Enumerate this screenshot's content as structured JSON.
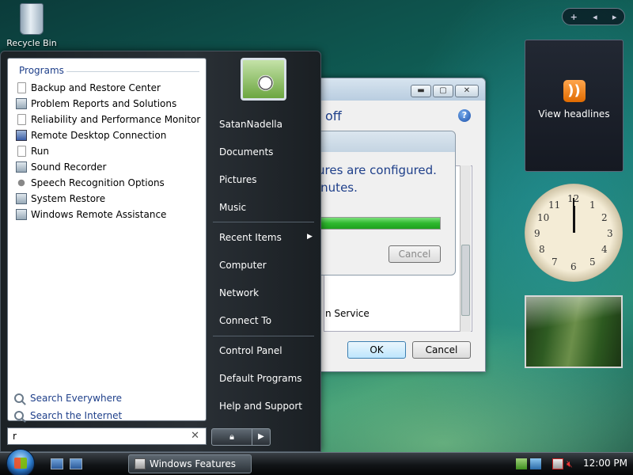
{
  "desktop": {
    "icons": [
      {
        "label": "Recycle Bin",
        "icon": "recycle-bin-icon"
      }
    ]
  },
  "sidebar": {
    "controls": {
      "add": "+",
      "prev": "◂",
      "next": "▸"
    },
    "rss": {
      "label": "View headlines",
      "icon": "rss-icon",
      "color": "#f08a24"
    },
    "clock": {
      "numbers": [
        "12",
        "1",
        "2",
        "3",
        "4",
        "5",
        "6",
        "7",
        "8",
        "9",
        "10",
        "11"
      ]
    }
  },
  "background_window": {
    "heading": "off",
    "service_text": "n Service",
    "ok_label": "OK",
    "cancel_label": "Cancel"
  },
  "progress_dialog": {
    "message_line1": "ures are configured.",
    "message_line2": "inutes.",
    "progress": 1.0,
    "cancel_label": "Cancel"
  },
  "start_menu": {
    "programs_header": "Programs",
    "programs": [
      {
        "label": "Backup and Restore Center",
        "icon": "page-icon"
      },
      {
        "label": "Problem Reports and Solutions",
        "icon": "monitor-icon"
      },
      {
        "label": "Reliability and Performance Monitor",
        "icon": "page-icon"
      },
      {
        "label": "Remote Desktop Connection",
        "icon": "remote-desktop-icon"
      },
      {
        "label": "Run",
        "icon": "page-icon"
      },
      {
        "label": "Sound Recorder",
        "icon": "monitor-icon"
      },
      {
        "label": "Speech Recognition Options",
        "icon": "microphone-icon"
      },
      {
        "label": "System Restore",
        "icon": "monitor-icon"
      },
      {
        "label": "Windows Remote Assistance",
        "icon": "monitor-icon"
      }
    ],
    "search_everywhere": "Search Everywhere",
    "search_internet": "Search the Internet",
    "search_value": "r",
    "search_clear": "✕",
    "user_name": "SatanNadella",
    "right_items": {
      "documents": "Documents",
      "pictures": "Pictures",
      "music": "Music",
      "recent_items": "Recent Items",
      "computer": "Computer",
      "network": "Network",
      "connect_to": "Connect To",
      "control_panel": "Control Panel",
      "default_programs": "Default Programs",
      "help_support": "Help and Support"
    },
    "power": {
      "lock_icon": "lock-icon",
      "arrow": "▶"
    }
  },
  "taskbar": {
    "task_label": "Windows Features",
    "clock": "12:00 PM",
    "tray_icons": [
      "network-icon",
      "security-icon",
      "network-disconnected-icon",
      "volume-muted-icon"
    ]
  }
}
